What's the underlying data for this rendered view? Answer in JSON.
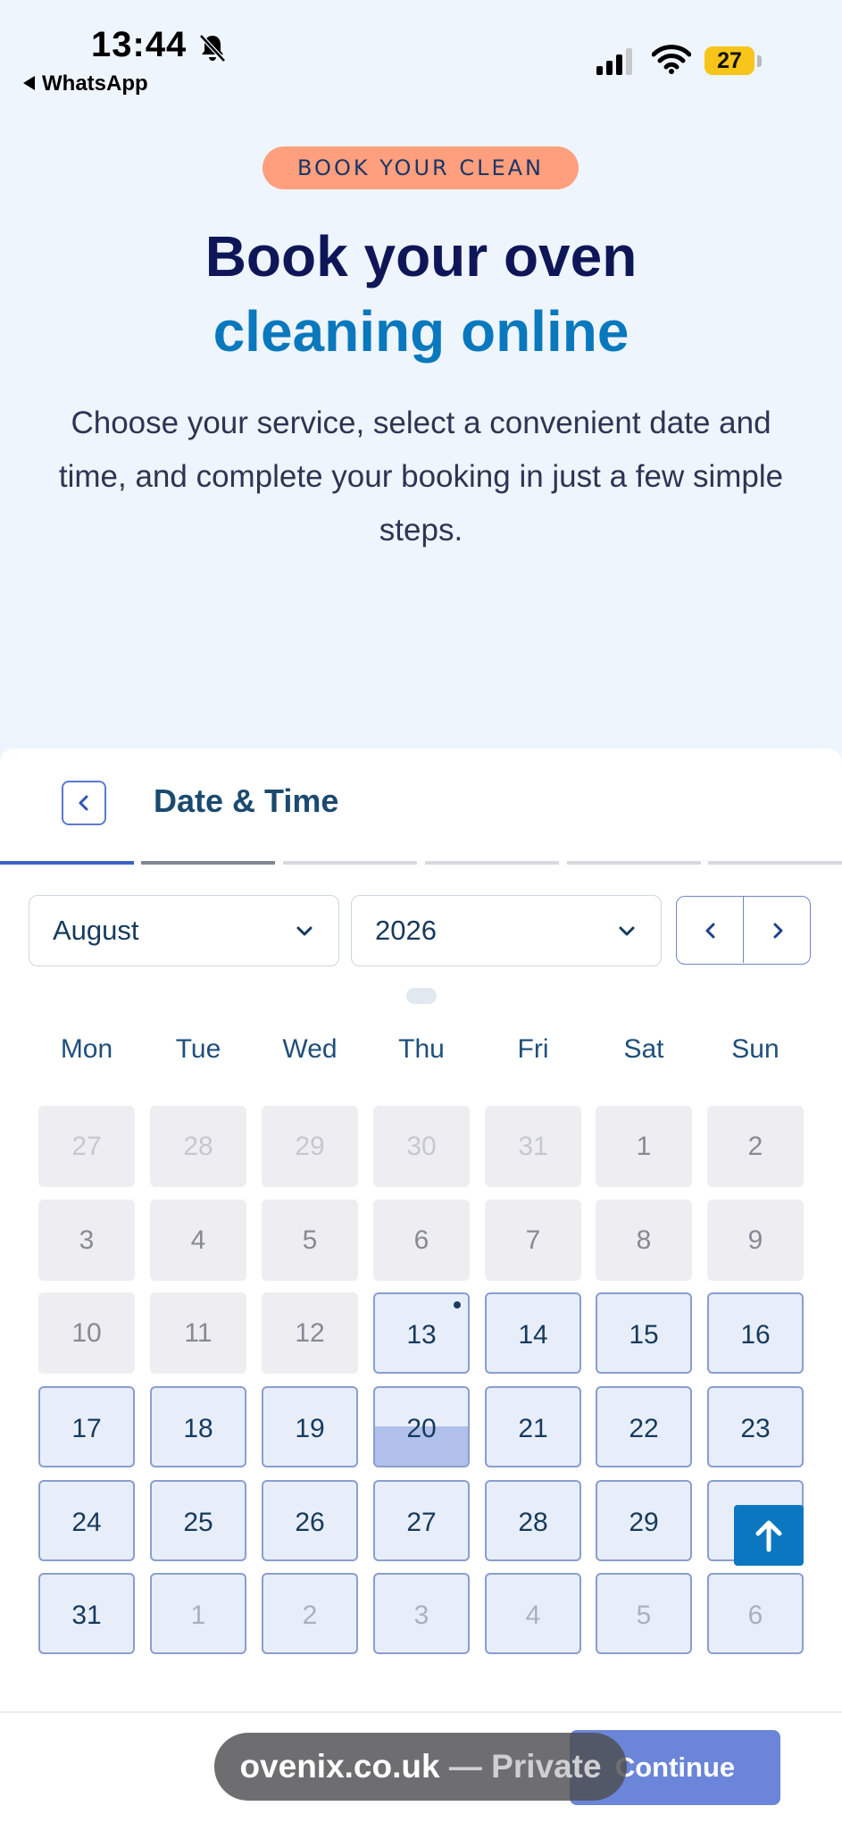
{
  "status_bar": {
    "time": "13:44",
    "back_app": "WhatsApp",
    "battery": "27"
  },
  "hero": {
    "badge": "BOOK YOUR CLEAN",
    "title_line1": "Book your oven",
    "title_line2": "cleaning online",
    "description": "Choose your service, select a convenient date and time, and complete your booking in just a few simple steps."
  },
  "booking": {
    "title": "Date & Time",
    "month": "August",
    "year": "2026",
    "weekdays": [
      "Mon",
      "Tue",
      "Wed",
      "Thu",
      "Fri",
      "Sat",
      "Sun"
    ],
    "weeks": [
      [
        {
          "d": "27",
          "s": "out"
        },
        {
          "d": "28",
          "s": "out"
        },
        {
          "d": "29",
          "s": "out"
        },
        {
          "d": "30",
          "s": "out"
        },
        {
          "d": "31",
          "s": "out"
        },
        {
          "d": "1",
          "s": "past"
        },
        {
          "d": "2",
          "s": "past"
        }
      ],
      [
        {
          "d": "3",
          "s": "past"
        },
        {
          "d": "4",
          "s": "past"
        },
        {
          "d": "5",
          "s": "past"
        },
        {
          "d": "6",
          "s": "past"
        },
        {
          "d": "7",
          "s": "past"
        },
        {
          "d": "8",
          "s": "past"
        },
        {
          "d": "9",
          "s": "past"
        }
      ],
      [
        {
          "d": "10",
          "s": "past"
        },
        {
          "d": "11",
          "s": "past"
        },
        {
          "d": "12",
          "s": "past"
        },
        {
          "d": "13",
          "s": "today"
        },
        {
          "d": "14",
          "s": "avail"
        },
        {
          "d": "15",
          "s": "avail"
        },
        {
          "d": "16",
          "s": "avail"
        }
      ],
      [
        {
          "d": "17",
          "s": "avail"
        },
        {
          "d": "18",
          "s": "avail"
        },
        {
          "d": "19",
          "s": "avail"
        },
        {
          "d": "20",
          "s": "selected"
        },
        {
          "d": "21",
          "s": "avail"
        },
        {
          "d": "22",
          "s": "avail"
        },
        {
          "d": "23",
          "s": "avail"
        }
      ],
      [
        {
          "d": "24",
          "s": "avail"
        },
        {
          "d": "25",
          "s": "avail"
        },
        {
          "d": "26",
          "s": "avail"
        },
        {
          "d": "27",
          "s": "avail"
        },
        {
          "d": "28",
          "s": "avail"
        },
        {
          "d": "29",
          "s": "avail"
        },
        {
          "d": "",
          "s": "avail"
        }
      ],
      [
        {
          "d": "31",
          "s": "avail"
        },
        {
          "d": "1",
          "s": "next"
        },
        {
          "d": "2",
          "s": "next"
        },
        {
          "d": "3",
          "s": "next"
        },
        {
          "d": "4",
          "s": "next"
        },
        {
          "d": "5",
          "s": "next"
        },
        {
          "d": "6",
          "s": "next"
        }
      ]
    ],
    "continue_label": "Continue"
  },
  "browser": {
    "domain": "ovenix.co.uk",
    "mode": " — Private"
  },
  "colors": {
    "accent_navy": "#0f1658",
    "accent_blue": "#0a78bd",
    "badge_bg": "#ff9f7d",
    "button": "#6b85d8"
  }
}
